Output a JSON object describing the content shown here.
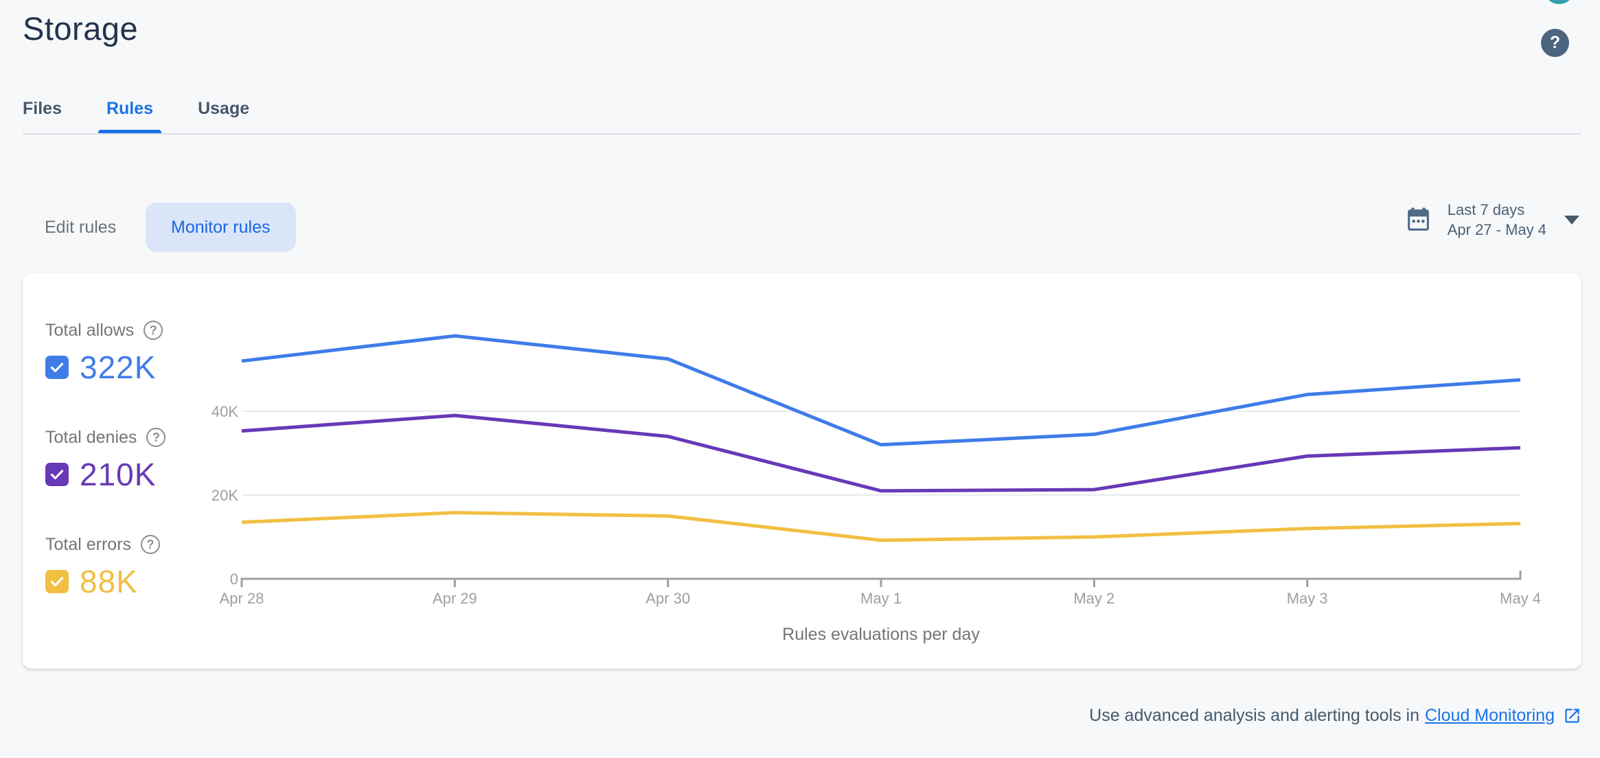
{
  "header": {
    "title": "Storage"
  },
  "icons": {
    "help_glyph": "?"
  },
  "tabs": {
    "items": [
      {
        "label": "Files",
        "active": false
      },
      {
        "label": "Rules",
        "active": true
      },
      {
        "label": "Usage",
        "active": false
      }
    ]
  },
  "toolbar": {
    "edit_rules_label": "Edit rules",
    "monitor_rules_label": "Monitor rules"
  },
  "date_filter": {
    "preset": "Last 7 days",
    "range": "Apr 27 - May 4"
  },
  "legend": {
    "entries": [
      {
        "label": "Total allows",
        "value": "322K",
        "checked": true
      },
      {
        "label": "Total denies",
        "value": "210K",
        "checked": true
      },
      {
        "label": "Total errors",
        "value": "88K",
        "checked": true
      }
    ]
  },
  "chart_data": {
    "type": "line",
    "title": "Rules evaluations per day",
    "categories": [
      "Apr 28",
      "Apr 29",
      "Apr 30",
      "May 1",
      "May 2",
      "May 3",
      "May 4"
    ],
    "series": [
      {
        "name": "Total allows",
        "color": "#3f7ce8",
        "values": [
          52000,
          58000,
          52500,
          32000,
          34500,
          44000,
          47500
        ]
      },
      {
        "name": "Total denies",
        "color": "#6639b7",
        "values": [
          35300,
          39000,
          34000,
          21000,
          21300,
          29300,
          31300
        ]
      },
      {
        "name": "Total errors",
        "color": "#f1bf42",
        "values": [
          13500,
          15800,
          15000,
          9200,
          10000,
          12000,
          13200
        ]
      }
    ],
    "yticks": [
      {
        "value": 0,
        "label": "0"
      },
      {
        "value": 20000,
        "label": "20K"
      },
      {
        "value": 40000,
        "label": "40K"
      }
    ],
    "ylim": [
      0,
      70000
    ],
    "grid": true,
    "legend_position": "left",
    "axis_color": "#9aa0a6",
    "grid_color": "#e8eaed",
    "tick_label_color": "#9a9fa4"
  },
  "footer": {
    "text": "Use advanced analysis and alerting tools in",
    "link_label": "Cloud Monitoring"
  }
}
